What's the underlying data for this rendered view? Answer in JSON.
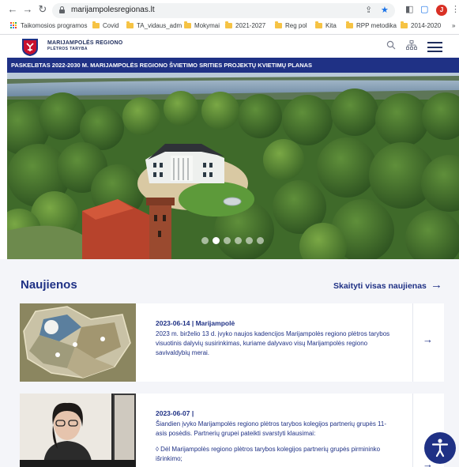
{
  "browser": {
    "url": "marijampolesregionas.lt",
    "profile_initial": "J",
    "bookmarks": [
      {
        "label": "Taikomosios programos",
        "type": "apps"
      },
      {
        "label": "Covid",
        "type": "folder"
      },
      {
        "label": "TA_vidaus_adm",
        "type": "folder"
      },
      {
        "label": "Mokymai",
        "type": "folder"
      },
      {
        "label": "2021-2027",
        "type": "folder"
      },
      {
        "label": "Reg pol",
        "type": "folder"
      },
      {
        "label": "Kita",
        "type": "folder"
      },
      {
        "label": "RPP metodika",
        "type": "folder"
      },
      {
        "label": "2014-2020",
        "type": "folder"
      }
    ],
    "more_bookmarks": "»",
    "icons": [
      "back-icon",
      "forward-icon",
      "reload-icon",
      "lock-icon",
      "share-icon",
      "star-icon",
      "sidebar-icon",
      "menu-dots-icon"
    ]
  },
  "site": {
    "brand_line1": "MARIJAMPOLĖS REGIONO",
    "brand_line2": "PLĖTROS TARYBA",
    "header_icons": [
      "search-icon",
      "sitemap-icon",
      "hamburger-menu-icon"
    ],
    "announcement": "PASKELBTAS 2022-2030 M. MARIJAMPOLĖS REGIONO ŠVIETIMO SRITIES PROJEKTŲ KVIETIMŲ PLANAS",
    "slider": {
      "count": 6,
      "active": 2
    },
    "colors": {
      "brand_blue": "#1f3185",
      "news_bg": "#f4f5f9",
      "accent_red": "#d93025"
    }
  },
  "news": {
    "title": "Naujienos",
    "read_all": "Skaityti visas naujienas",
    "read_all_arrow": "→",
    "items": [
      {
        "date": "2023-06-14 | Marijampolė",
        "text": "2023 m. birželio 13 d. įvyko naujos kadencijos Marijampolės regiono plėtros tarybos visuotinis dalyvių susirinkimas, kuriame dalyvavo visų Marijampolės regiono savivaldybių merai.",
        "arrow": "→"
      },
      {
        "date": "2023-06-07 |",
        "text": "Šiandien įvyko Marijampolės regiono plėtros tarybos kolegijos partnerių grupės 11-asis posėdis. Partnerių grupei pateikti svarstyti klausimai:",
        "text2": "◊ Dėl Marijampolės regiono plėtros tarybos kolegijos partnerių grupės pirmininko išrinkimo;",
        "arrow": "→"
      }
    ]
  }
}
